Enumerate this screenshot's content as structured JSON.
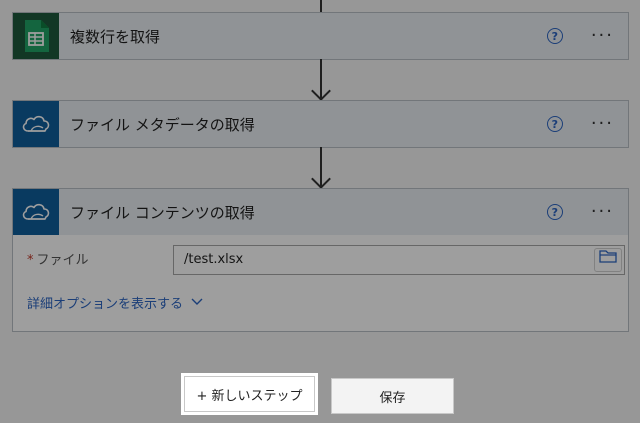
{
  "steps": [
    {
      "title": "複数行を取得",
      "icon": "excel-sheets-icon",
      "icon_bg": "#1e5a3c"
    },
    {
      "title": "ファイル メタデータの取得",
      "icon": "onedrive-cloud-icon",
      "icon_bg": "#0f5e9c"
    },
    {
      "title": "ファイル コンテンツの取得",
      "icon": "onedrive-cloud-icon",
      "icon_bg": "#0f5e9c"
    }
  ],
  "help_symbol": "?",
  "more_symbol": "···",
  "file_field": {
    "label": "ファイル",
    "required_mark": "*",
    "value": "/test.xlsx"
  },
  "advanced_options_label": "詳細オプションを表示する",
  "new_step_label": "+ 新しいステップ",
  "save_label": "保存",
  "colors": {
    "accent": "#2c65c2",
    "header_bg": "#e9eef3",
    "overlay": "rgba(0,0,0,0.38)"
  }
}
